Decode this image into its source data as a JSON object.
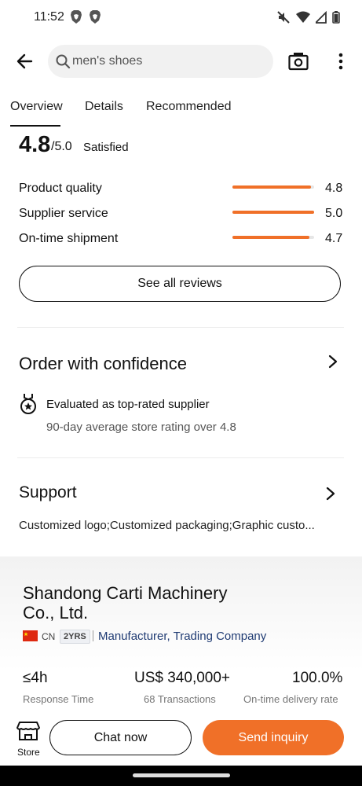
{
  "status_bar": {
    "time": "11:52"
  },
  "search": {
    "query": "men's shoes"
  },
  "tabs": [
    {
      "label": "Overview"
    },
    {
      "label": "Details"
    },
    {
      "label": "Recommended"
    }
  ],
  "rating": {
    "score": "4.8",
    "out_of": "/5.0",
    "label": "Satisfied",
    "metrics": [
      {
        "label": "Product quality",
        "value": "4.8",
        "fraction": 0.96
      },
      {
        "label": "Supplier service",
        "value": "5.0",
        "fraction": 1.0
      },
      {
        "label": "On-time shipment",
        "value": "4.7",
        "fraction": 0.94
      }
    ],
    "see_all_label": "See all reviews"
  },
  "confidence": {
    "title": "Order with confidence",
    "eval_title": "Evaluated as top-rated supplier",
    "eval_sub": "90-day average store rating over 4.8"
  },
  "support": {
    "title": "Support",
    "text": "Customized logo;Customized packaging;Graphic custo..."
  },
  "supplier": {
    "name": "Shandong Carti Machinery Co., Ltd.",
    "country": "CN",
    "years": "2YRS",
    "business_type": "Manufacturer, Trading Company",
    "stats": [
      {
        "value": "≤4h",
        "label": "Response Time"
      },
      {
        "value": "US$ 340,000+",
        "label": "68 Transactions"
      },
      {
        "value": "100.0%",
        "label": "On-time delivery rate"
      }
    ]
  },
  "bottom_bar": {
    "store_label": "Store",
    "chat_label": "Chat now",
    "inquiry_label": "Send inquiry"
  },
  "colors": {
    "accent": "#f07028",
    "link_navy": "#1f3b73"
  }
}
